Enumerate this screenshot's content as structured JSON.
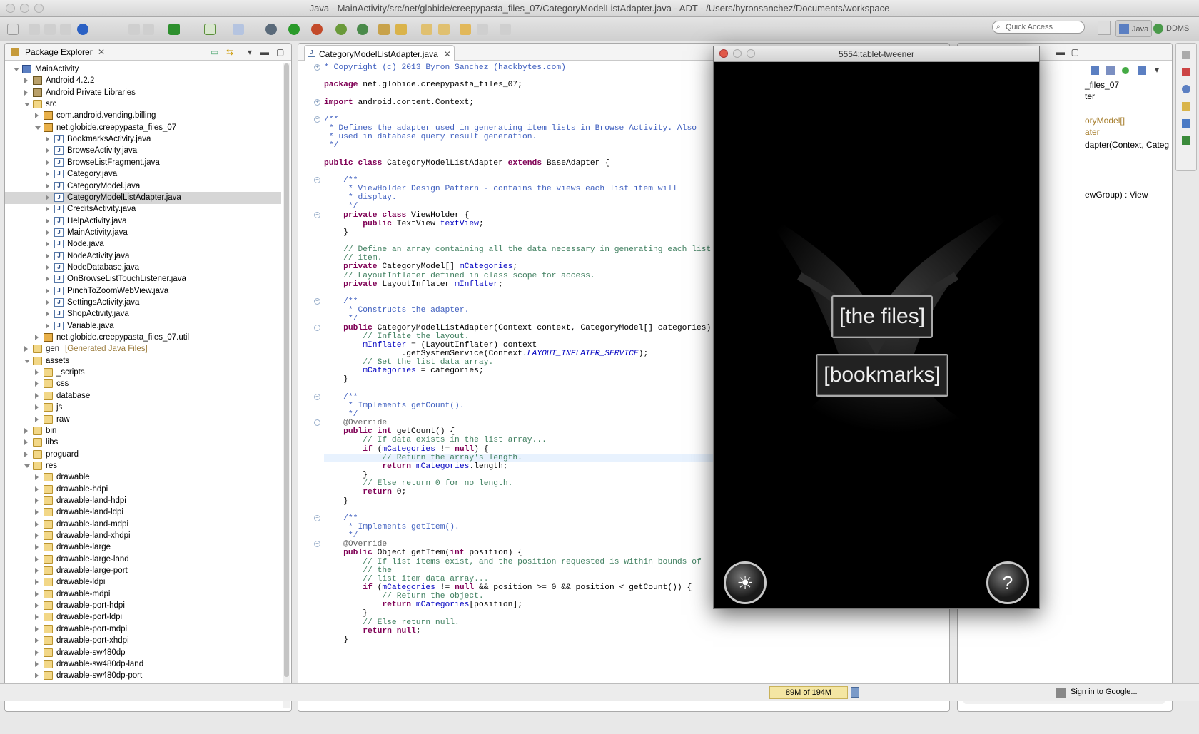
{
  "window": {
    "title": "Java - MainActivity/src/net/globide/creepypasta_files_07/CategoryModelListAdapter.java - ADT - /Users/byronsanchez/Documents/workspace"
  },
  "toolbar": {
    "quick_access_placeholder": "Quick Access",
    "perspective_java": "Java",
    "perspective_ddms": "DDMS"
  },
  "package_explorer": {
    "title": "Package Explorer",
    "items": [
      {
        "label": "MainActivity",
        "icon": "project-icon",
        "note": ""
      },
      {
        "label": "Android 4.2.2",
        "icon": "library-icon",
        "note": ""
      },
      {
        "label": "Android Private Libraries",
        "icon": "library-icon",
        "note": ""
      },
      {
        "label": "src",
        "icon": "folder-icon",
        "note": ""
      },
      {
        "label": "com.android.vending.billing",
        "icon": "package-icon",
        "note": ""
      },
      {
        "label": "net.globide.creepypasta_files_07",
        "icon": "package-icon",
        "note": ""
      },
      {
        "label": "BookmarksActivity.java",
        "icon": "java-file-icon",
        "note": ""
      },
      {
        "label": "BrowseActivity.java",
        "icon": "java-file-icon",
        "note": ""
      },
      {
        "label": "BrowseListFragment.java",
        "icon": "java-file-icon",
        "note": ""
      },
      {
        "label": "Category.java",
        "icon": "java-file-icon",
        "note": ""
      },
      {
        "label": "CategoryModel.java",
        "icon": "java-file-icon",
        "note": ""
      },
      {
        "label": "CategoryModelListAdapter.java",
        "icon": "java-file-icon",
        "note": ""
      },
      {
        "label": "CreditsActivity.java",
        "icon": "java-file-icon",
        "note": ""
      },
      {
        "label": "HelpActivity.java",
        "icon": "java-file-icon",
        "note": ""
      },
      {
        "label": "MainActivity.java",
        "icon": "java-file-icon",
        "note": ""
      },
      {
        "label": "Node.java",
        "icon": "java-file-icon",
        "note": ""
      },
      {
        "label": "NodeActivity.java",
        "icon": "java-file-icon",
        "note": ""
      },
      {
        "label": "NodeDatabase.java",
        "icon": "java-file-icon",
        "note": ""
      },
      {
        "label": "OnBrowseListTouchListener.java",
        "icon": "java-file-icon",
        "note": ""
      },
      {
        "label": "PinchToZoomWebView.java",
        "icon": "java-file-icon",
        "note": ""
      },
      {
        "label": "SettingsActivity.java",
        "icon": "java-file-icon",
        "note": ""
      },
      {
        "label": "ShopActivity.java",
        "icon": "java-file-icon",
        "note": ""
      },
      {
        "label": "Variable.java",
        "icon": "java-file-icon",
        "note": ""
      },
      {
        "label": "net.globide.creepypasta_files_07.util",
        "icon": "package-icon",
        "note": ""
      },
      {
        "label": "gen",
        "icon": "folder-icon",
        "note": "[Generated Java Files]"
      },
      {
        "label": "assets",
        "icon": "folder-icon",
        "note": ""
      },
      {
        "label": "_scripts",
        "icon": "folder-icon",
        "note": ""
      },
      {
        "label": "css",
        "icon": "folder-icon",
        "note": ""
      },
      {
        "label": "database",
        "icon": "folder-icon",
        "note": ""
      },
      {
        "label": "js",
        "icon": "folder-icon",
        "note": ""
      },
      {
        "label": "raw",
        "icon": "folder-icon",
        "note": ""
      },
      {
        "label": "bin",
        "icon": "folder-icon",
        "note": ""
      },
      {
        "label": "libs",
        "icon": "folder-icon",
        "note": ""
      },
      {
        "label": "proguard",
        "icon": "folder-icon",
        "note": ""
      },
      {
        "label": "res",
        "icon": "folder-icon",
        "note": ""
      },
      {
        "label": "drawable",
        "icon": "folder-icon",
        "note": ""
      },
      {
        "label": "drawable-hdpi",
        "icon": "folder-icon",
        "note": ""
      },
      {
        "label": "drawable-land-hdpi",
        "icon": "folder-icon",
        "note": ""
      },
      {
        "label": "drawable-land-ldpi",
        "icon": "folder-icon",
        "note": ""
      },
      {
        "label": "drawable-land-mdpi",
        "icon": "folder-icon",
        "note": ""
      },
      {
        "label": "drawable-land-xhdpi",
        "icon": "folder-icon",
        "note": ""
      },
      {
        "label": "drawable-large",
        "icon": "folder-icon",
        "note": ""
      },
      {
        "label": "drawable-large-land",
        "icon": "folder-icon",
        "note": ""
      },
      {
        "label": "drawable-large-port",
        "icon": "folder-icon",
        "note": ""
      },
      {
        "label": "drawable-ldpi",
        "icon": "folder-icon",
        "note": ""
      },
      {
        "label": "drawable-mdpi",
        "icon": "folder-icon",
        "note": ""
      },
      {
        "label": "drawable-port-hdpi",
        "icon": "folder-icon",
        "note": ""
      },
      {
        "label": "drawable-port-ldpi",
        "icon": "folder-icon",
        "note": ""
      },
      {
        "label": "drawable-port-mdpi",
        "icon": "folder-icon",
        "note": ""
      },
      {
        "label": "drawable-port-xhdpi",
        "icon": "folder-icon",
        "note": ""
      },
      {
        "label": "drawable-sw480dp",
        "icon": "folder-icon",
        "note": ""
      },
      {
        "label": "drawable-sw480dp-land",
        "icon": "folder-icon",
        "note": ""
      },
      {
        "label": "drawable-sw480dp-port",
        "icon": "folder-icon",
        "note": ""
      }
    ],
    "selected": "CategoryModelListAdapter.java"
  },
  "editor": {
    "tab_label": "CategoryModelListAdapter.java",
    "lines": [
      "* Copyright (c) 2013 Byron Sanchez (hackbytes.com)",
      "",
      "package net.globide.creepypasta_files_07;",
      "",
      "import android.content.Context;",
      "",
      "/**",
      " * Defines the adapter used in generating item lists in Browse Activity. Also",
      " * used in database query result generation.",
      " */",
      "",
      "public class CategoryModelListAdapter extends BaseAdapter {",
      "",
      "    /**",
      "     * ViewHolder Design Pattern - contains the views each list item will",
      "     * display.",
      "     */",
      "    private class ViewHolder {",
      "        public TextView textView;",
      "    }",
      "",
      "    // Define an array containing all the data necessary in generating each list",
      "    // item.",
      "    private CategoryModel[] mCategories;",
      "    // LayoutInflater defined in class scope for access.",
      "    private LayoutInflater mInflater;",
      "",
      "    /**",
      "     * Constructs the adapter.",
      "     */",
      "    public CategoryModelListAdapter(Context context, CategoryModel[] categories) {",
      "        // Inflate the layout.",
      "        mInflater = (LayoutInflater) context",
      "                .getSystemService(Context.LAYOUT_INFLATER_SERVICE);",
      "        // Set the list data array.",
      "        mCategories = categories;",
      "    }",
      "",
      "    /**",
      "     * Implements getCount().",
      "     */",
      "    @Override",
      "    public int getCount() {",
      "        // If data exists in the list array...",
      "        if (mCategories != null) {",
      "            // Return the array's length.",
      "            return mCategories.length;",
      "        }",
      "        // Else return 0 for no length.",
      "        return 0;",
      "    }",
      "",
      "    /**",
      "     * Implements getItem().",
      "     */",
      "    @Override",
      "    public Object getItem(int position) {",
      "        // If list items exist, and the position requested is within bounds of",
      "        // the",
      "        // list item data array...",
      "        if (mCategories != null && position >= 0 && position < getCount()) {",
      "            // Return the object.",
      "            return mCategories[position];",
      "        }",
      "        // Else return null.",
      "        return null;",
      "    }"
    ]
  },
  "outline": {
    "items": [
      "_files_07",
      "ter",
      "oryModel[]",
      "ater",
      "dapter(Context, Categ",
      "ewGroup) : View"
    ]
  },
  "emulator": {
    "title": "5554:tablet-tweener",
    "btn_files": "[the files]",
    "btn_bookmarks": "[bookmarks]",
    "settings_icon": "☀",
    "help_icon": "?"
  },
  "status": {
    "memory": "89M of 194M",
    "sign_in": "Sign in to Google..."
  },
  "colors": {
    "keyword": "#7f0055",
    "javadoc": "#3f5fbf",
    "line_comment": "#3f7f5f",
    "field": "#0000c0"
  }
}
